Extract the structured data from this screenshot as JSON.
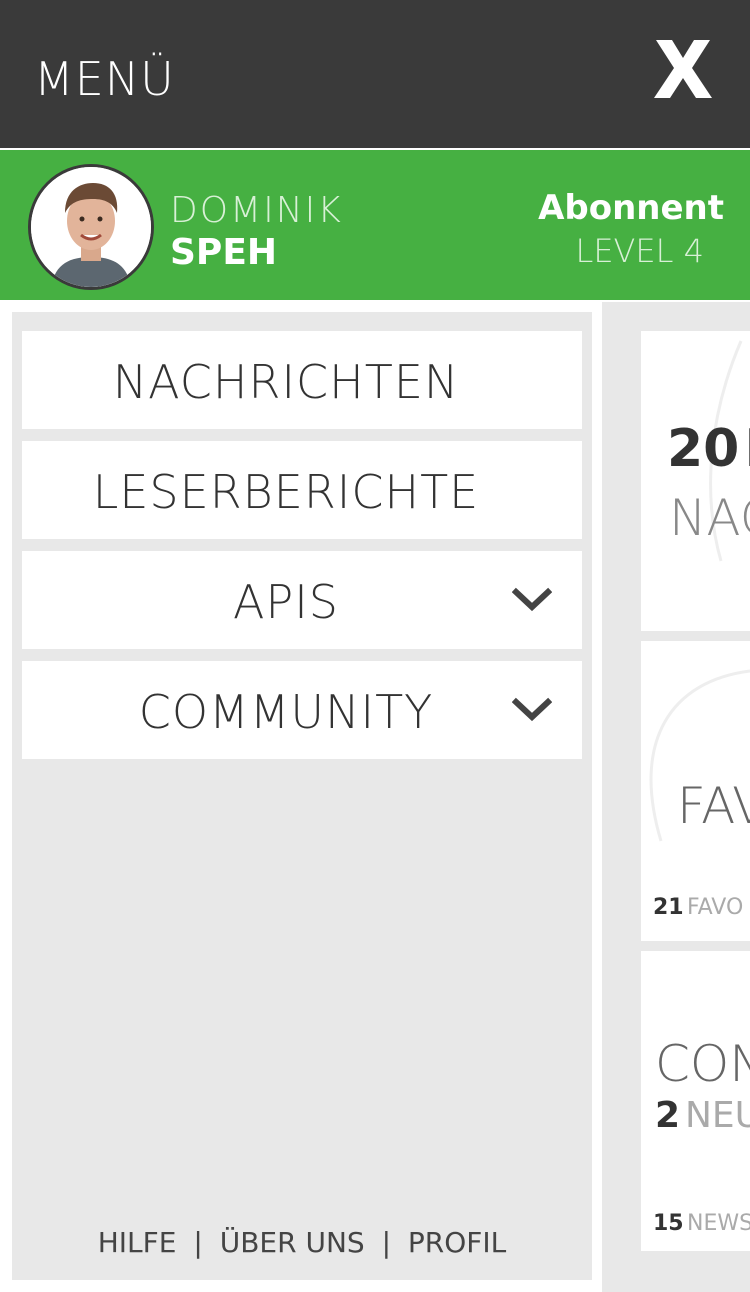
{
  "header": {
    "menu_title": "MENÜ",
    "close_label": "X"
  },
  "user": {
    "first_name": "DOMINIK",
    "last_name": "SPEH",
    "role": "Abonnent",
    "level": "LEVEL 4",
    "avatar_icon": "user-avatar"
  },
  "nav": {
    "items": [
      {
        "label": "NACHRICHTEN",
        "has_submenu": false
      },
      {
        "label": "LESERBERICHTE",
        "has_submenu": false
      },
      {
        "label": "APIS",
        "has_submenu": true
      },
      {
        "label": "COMMUNITY",
        "has_submenu": true
      }
    ]
  },
  "footer": {
    "help": "HILFE",
    "about": "ÜBER UNS",
    "profile": "PROFIL",
    "separator": "|"
  },
  "cards": [
    {
      "count": "20",
      "count_suffix": "N",
      "subtitle": "NAC"
    },
    {
      "title": "FAV",
      "count": "21",
      "count_label": "FAVO"
    },
    {
      "title": "CON",
      "count": "2",
      "count_label": "NEU",
      "footer_count": "15",
      "footer_label": "NEWS"
    }
  ],
  "colors": {
    "topbar": "#3a3a3a",
    "accent_green": "#46b042",
    "panel_gray": "#e8e8e8"
  }
}
